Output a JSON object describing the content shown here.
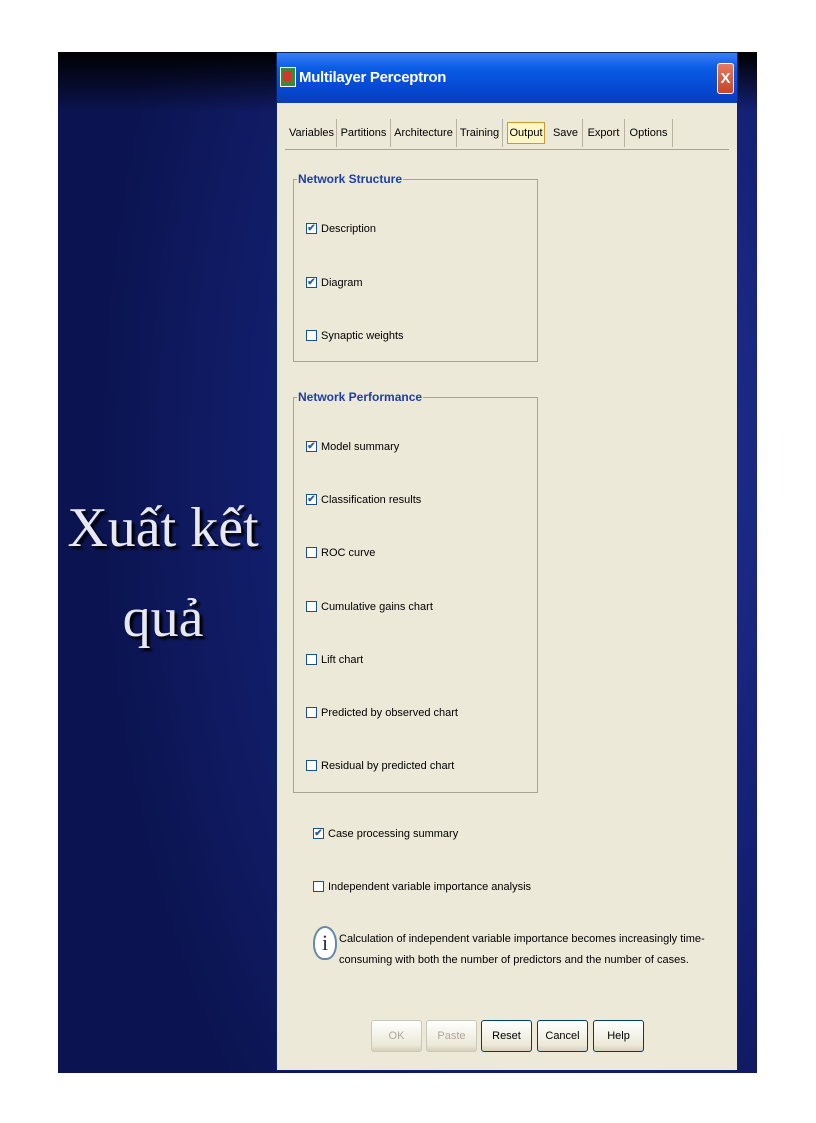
{
  "slide": {
    "title_line1": "Xuất kết",
    "title_line2": "quả"
  },
  "dialog": {
    "title": "Multilayer Perceptron",
    "close_glyph": "X",
    "tabs": [
      "Variables",
      "Partitions",
      "Architecture",
      "Training",
      "Output",
      "Save",
      "Export",
      "Options"
    ],
    "active_tab": "Output",
    "network_structure": {
      "title": "Network Structure",
      "items": [
        {
          "label": "Description",
          "checked": true
        },
        {
          "label": "Diagram",
          "checked": true
        },
        {
          "label": "Synaptic weights",
          "checked": false
        }
      ]
    },
    "network_performance": {
      "title": "Network Performance",
      "items": [
        {
          "label": "Model summary",
          "checked": true
        },
        {
          "label": "Classification results",
          "checked": true
        },
        {
          "label": "ROC curve",
          "checked": false
        },
        {
          "label": "Cumulative gains chart",
          "checked": false
        },
        {
          "label": "Lift chart",
          "checked": false
        },
        {
          "label": "Predicted by observed chart",
          "checked": false
        },
        {
          "label": "Residual by predicted chart",
          "checked": false
        }
      ]
    },
    "case_processing": {
      "label": "Case processing summary",
      "checked": true
    },
    "importance_analysis": {
      "label": "Independent variable importance analysis",
      "checked": false
    },
    "info_icon_glyph": "i",
    "info_text": "Calculation of independent variable importance becomes increasingly time-consuming with both the number of predictors and the number of cases.",
    "buttons": {
      "ok": "OK",
      "paste": "Paste",
      "reset": "Reset",
      "cancel": "Cancel",
      "help": "Help"
    }
  },
  "colors": {
    "titlebar": "#0a5ce6",
    "dialog_bg": "#ece9d8",
    "group_title": "#1e3fa0",
    "slide_bg": "#15237a",
    "active_tab_bg": "#fff6c8"
  },
  "icons": {
    "app": "spss-app-icon",
    "close": "close-icon",
    "info": "info-icon",
    "check": "checkmark-icon"
  }
}
